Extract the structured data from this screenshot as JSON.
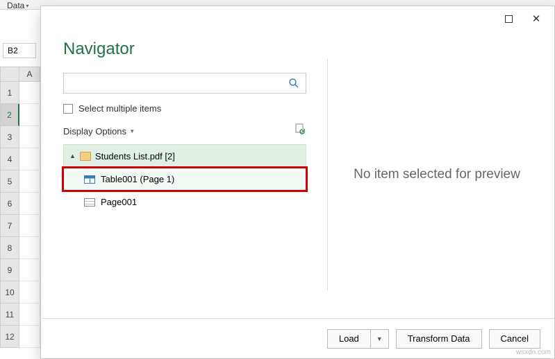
{
  "ribbon": {
    "tab_label": "Data"
  },
  "namebox": {
    "value": "B2"
  },
  "sheet": {
    "col": "A",
    "rows": [
      "1",
      "2",
      "3",
      "4",
      "5",
      "6",
      "7",
      "8",
      "9",
      "10",
      "11",
      "12"
    ],
    "active_row_index": 1
  },
  "dialog": {
    "title": "Navigator",
    "search_placeholder": "",
    "select_multiple_label": "Select multiple items",
    "display_options_label": "Display Options",
    "tree": {
      "root_label": "Students List.pdf [2]",
      "items": [
        {
          "label": "Table001 (Page 1)",
          "type": "table",
          "highlighted": true
        },
        {
          "label": "Page001",
          "type": "page",
          "highlighted": false
        }
      ]
    },
    "preview_empty": "No item selected for preview",
    "buttons": {
      "load": "Load",
      "transform": "Transform Data",
      "cancel": "Cancel"
    }
  },
  "watermark": "wsxdn.com"
}
